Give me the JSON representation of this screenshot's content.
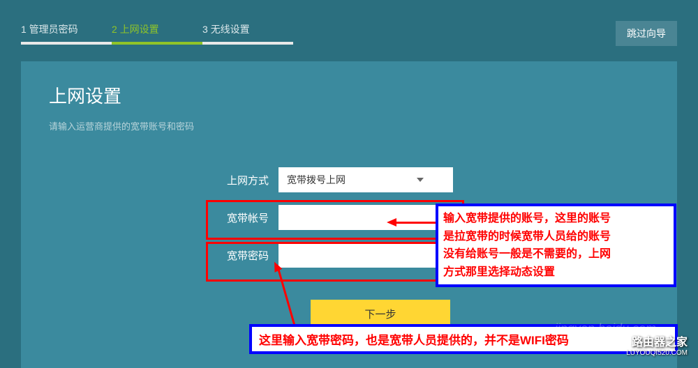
{
  "header": {
    "steps": [
      {
        "num": "1",
        "label": "管理员密码"
      },
      {
        "num": "2",
        "label": "上网设置"
      },
      {
        "num": "3",
        "label": "无线设置"
      }
    ],
    "skip": "跳过向导"
  },
  "page": {
    "title": "上网设置",
    "subtitle": "请输入运营商提供的宽带账号和密码"
  },
  "form": {
    "connection_label": "上网方式",
    "connection_value": "宽带拨号上网",
    "account_label": "宽带帐号",
    "account_value": "",
    "password_label": "宽带密码",
    "password_value": "",
    "next_button": "下一步"
  },
  "annotations": {
    "box1_line1": "输入宽带提供的账号，这里的账号",
    "box1_line2": "是拉宽带的时候宽带人员给的账号",
    "box1_line3": "没有给账号一般是不需要的，上网",
    "box1_line4": "方式那里选择动态设置",
    "box2": "这里输入宽带密码，也是宽带人员提供的，并不是WIFI密码"
  },
  "watermark": {
    "faded": "jingyan.baidu.com",
    "brand": "路由器之家",
    "url": "LUYOUQI520.COM"
  }
}
